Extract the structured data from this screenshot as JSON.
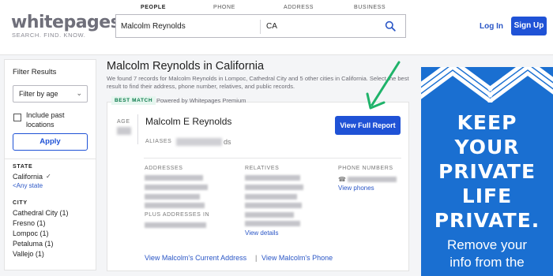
{
  "header": {
    "logo": "whitepages",
    "tagline": "SEARCH. FIND. KNOW.",
    "tabs": [
      "PEOPLE",
      "PHONE",
      "ADDRESS",
      "BUSINESS"
    ],
    "search_name": "Malcolm Reynolds",
    "search_location": "CA",
    "login_label": "Log In",
    "signup_label": "Sign Up"
  },
  "filter": {
    "title": "Filter Results",
    "sort_label": "Filter by age",
    "include_past_label": "Include past locations",
    "apply_label": "Apply",
    "state_heading": "STATE",
    "state_value": "California",
    "any_state_link": "<Any state",
    "city_heading": "CITY",
    "cities": [
      "Cathedral City (1)",
      "Fresno (1)",
      "Lompoc (1)",
      "Petaluma (1)",
      "Vallejo (1)"
    ]
  },
  "results": {
    "headline": "Malcolm Reynolds in California",
    "summary": "We found 7 records for Malcolm Reynolds in Lompoc, Cathedral City and 5 other cities in California. Select the best result to find their address, phone number, relatives, and public records.",
    "badge": "BEST MATCH",
    "badge_note": "Powered by Whitepages Premium",
    "card": {
      "age_label": "AGE",
      "name": "Malcolm E Reynolds",
      "aliases_label": "ALIASES",
      "aliases_tail": "ds",
      "report_button": "View Full Report",
      "addresses_label": "ADDRESSES",
      "plus_addresses_label": "PLUS ADDRESSES IN",
      "relatives_label": "RELATIVES",
      "view_details": "View details",
      "phone_label": "PHONE NUMBERS",
      "view_phones": "View phones",
      "footer_address_link": "View Malcolm's Current Address",
      "footer_sep": "|",
      "footer_phone_link": "View Malcolm's Phone"
    }
  },
  "ad": {
    "lines": [
      "KEEP",
      "YOUR",
      "PRIVATE",
      "LIFE",
      "PRIVATE."
    ],
    "sub_lines": [
      "Remove your",
      "info from the"
    ]
  }
}
